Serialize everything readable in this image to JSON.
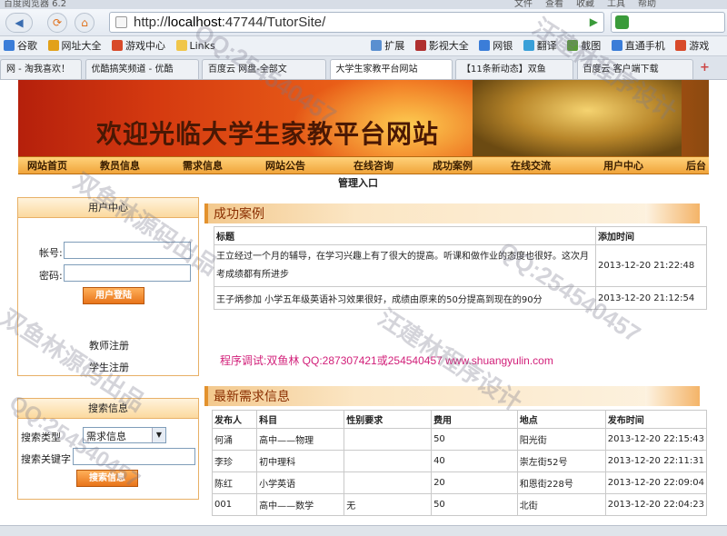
{
  "window": {
    "title": "百度阅览器 6.2",
    "menu": [
      "文件",
      "查看",
      "收藏",
      "工具",
      "帮助"
    ]
  },
  "browser": {
    "url_prefix": "http://",
    "url_host": "localhost",
    "url_rest": ":47744/TutorSite/",
    "bookmarks": [
      "谷歌",
      "网址大全",
      "游戏中心",
      "Links",
      "扩展",
      "影视大全",
      "网银",
      "翻译",
      "截图",
      "直通手机",
      "游戏"
    ],
    "tabs": [
      "网 - 淘我喜欢！",
      "优酷搞笑频道 - 优酷",
      "百度云 网盘-全部文",
      "大学生家教平台网站",
      "【11条新动态】双鱼",
      "百度云 客户端下载"
    ]
  },
  "site": {
    "banner_title": "欢迎光临大学生家教平台网站",
    "nav": [
      "网站首页",
      "教员信息",
      "需求信息",
      "网站公告",
      "在线咨询",
      "成功案例",
      "在线交流",
      "用户中心",
      "后台"
    ],
    "admin_entry": "管理入口"
  },
  "user_center": {
    "title": "用户中心",
    "account_label": "帐号:",
    "password_label": "密码:",
    "login_button": "用户登陆",
    "teacher_register": "教师注册",
    "student_register": "学生注册"
  },
  "search": {
    "title": "搜索信息",
    "type_label": "搜索类型",
    "type_selected": "需求信息",
    "keyword_label": "搜索关键字",
    "button": "搜索信息"
  },
  "cases": {
    "title": "成功案例",
    "headers": [
      "标题",
      "添加时间"
    ],
    "rows": [
      {
        "title_line1": "王立经过一个月的辅导，在学习兴趣上有了很大的提高。听课和做作业的态度也很好。这次月",
        "title_line2": "考成绩都有所进步",
        "time": "2013-12-20 21:22:48"
      },
      {
        "title_line1": "王子炳参加 小学五年级英语补习效果很好，成绩由原来的50分提高到现在的90分",
        "title_line2": "",
        "time": "2013-12-20 21:12:54"
      }
    ]
  },
  "debug_line": "程序调试:双鱼林 QQ:287307421或254540457 www.shuangyulin.com",
  "demands": {
    "title": "最新需求信息",
    "headers": [
      "发布人",
      "科目",
      "性别要求",
      "费用",
      "地点",
      "发布时间"
    ],
    "rows": [
      [
        "何涌",
        "高中——物理",
        "",
        "50",
        "阳光街",
        "2013-12-20 22:15:43"
      ],
      [
        "李珍",
        "初中理科",
        "",
        "40",
        "崇左街52号",
        "2013-12-20 22:11:31"
      ],
      [
        "陈红",
        "小学英语",
        "",
        "20",
        "和恩街228号",
        "2013-12-20 22:09:04"
      ],
      [
        "001",
        "高中——数学",
        "无",
        "50",
        "北街",
        "2013-12-20 22:04:23"
      ]
    ]
  },
  "watermarks": [
    "QQ:254540457",
    "双鱼林源码出品",
    "汪建林程序设计",
    "QQ:254540457",
    "汪建林程序设计",
    "双鱼林源码出品",
    "QQ:254540457"
  ]
}
